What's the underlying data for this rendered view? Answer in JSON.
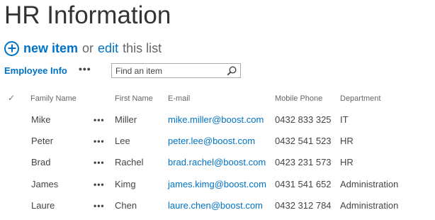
{
  "page": {
    "title": "HR Information"
  },
  "actions": {
    "new_item_label": "new item",
    "or_text": "or",
    "edit_label": "edit",
    "this_list_text": "this list"
  },
  "view": {
    "name": "Employee Info",
    "more_label": "•••"
  },
  "search": {
    "placeholder": "Find an item"
  },
  "table": {
    "check_header": "✓",
    "columns": {
      "family_name": "Family Name",
      "first_name": "First Name",
      "email": "E-mail",
      "mobile_phone": "Mobile Phone",
      "department": "Department"
    },
    "row_menu_label": "•••",
    "rows": [
      {
        "family_name": "Mike",
        "first_name": "Miller",
        "email": "mike.miller@boost.com",
        "mobile_phone": "0432 833 325",
        "department": "IT"
      },
      {
        "family_name": "Peter",
        "first_name": "Lee",
        "email": "peter.lee@boost.com",
        "mobile_phone": "0432 541 523",
        "department": "HR"
      },
      {
        "family_name": "Brad",
        "first_name": "Rachel",
        "email": "brad.rachel@boost.com",
        "mobile_phone": "0423 231 573",
        "department": "HR"
      },
      {
        "family_name": "James",
        "first_name": "Kimg",
        "email": "james.kimg@boost.com",
        "mobile_phone": "0431 541 652",
        "department": "Administration"
      },
      {
        "family_name": "Laure",
        "first_name": "Chen",
        "email": "laure.chen@boost.com",
        "mobile_phone": "0432 312 784",
        "department": "Administration"
      }
    ]
  },
  "colors": {
    "link": "#0072c6",
    "text": "#444444",
    "title": "#333333"
  }
}
